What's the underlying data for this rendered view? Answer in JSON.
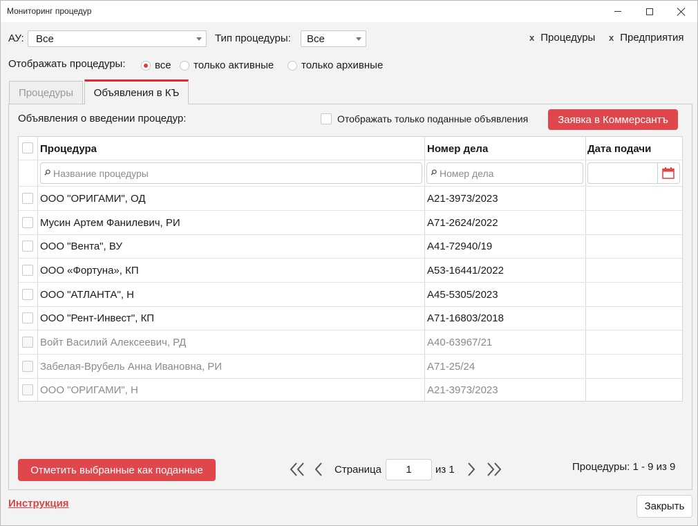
{
  "window": {
    "title": "Мониторинг процедур"
  },
  "filters": {
    "au_label": "АУ:",
    "au_value": "Все",
    "type_label": "Тип процедуры:",
    "type_value": "Все"
  },
  "quick_links": [
    {
      "x": "x",
      "label": "Процедуры"
    },
    {
      "x": "x",
      "label": "Предприятия"
    }
  ],
  "display": {
    "label": "Отображать процедуры:",
    "options": [
      {
        "label": "все",
        "selected": true
      },
      {
        "label": "только активные",
        "selected": false
      },
      {
        "label": "только архивные",
        "selected": false
      }
    ]
  },
  "tabs": [
    {
      "label": "Процедуры",
      "active": false
    },
    {
      "label": "Объявления в КЪ",
      "active": true
    }
  ],
  "panel": {
    "section_label": "Объявления о введении процедур:",
    "only_submitted_label": "Отображать только поданные объявления",
    "kommersant_button": "Заявка в Коммерсантъ"
  },
  "grid": {
    "columns": [
      "Процедура",
      "Номер дела",
      "Дата подачи"
    ],
    "filter_placeholders": {
      "name": "Название процедуры",
      "case": "Номер дела"
    },
    "rows": [
      {
        "name": "ООО \"ОРИГАМИ\", ОД",
        "case": "А21-3973/2023",
        "date": "",
        "active": true
      },
      {
        "name": "Мусин Артем Фанилевич, РИ",
        "case": "А71-2624/2022",
        "date": "",
        "active": true
      },
      {
        "name": "ООО \"Вента\", ВУ",
        "case": "А41-72940/19",
        "date": "",
        "active": true
      },
      {
        "name": "ООО «Фортуна», КП",
        "case": "А53-16441/2022",
        "date": "",
        "active": true
      },
      {
        "name": "ООО \"АТЛАНТА\", Н",
        "case": "А45-5305/2023",
        "date": "",
        "active": true
      },
      {
        "name": "ООО \"Рент-Инвест\", КП",
        "case": "А71-16803/2018",
        "date": "",
        "active": true
      },
      {
        "name": "Войт Василий Алексеевич, РД",
        "case": "А40-63967/21",
        "date": "",
        "active": false
      },
      {
        "name": "Забелая-Врубель Анна Ивановна, РИ",
        "case": "А71-25/24",
        "date": "",
        "active": false
      },
      {
        "name": "ООО \"ОРИГАМИ\", Н",
        "case": "А21-3973/2023",
        "date": "",
        "active": false
      }
    ]
  },
  "footer": {
    "mark_button": "Отметить выбранные как поданные",
    "page_label": "Страница",
    "page_value": "1",
    "page_of": "из 1",
    "summary": "Процедуры: 1 - 9 из 9",
    "instruction_link": "Инструкция",
    "close_button": "Закрыть"
  },
  "colors": {
    "accent": "#e0474c",
    "tab_underline": "#e8262c",
    "link": "#d64549"
  },
  "icons": [
    "minimize-icon",
    "maximize-icon",
    "close-icon",
    "chevron-down-icon",
    "search-icon",
    "calendar-icon",
    "first-page-icon",
    "prev-page-icon",
    "next-page-icon",
    "last-page-icon"
  ]
}
